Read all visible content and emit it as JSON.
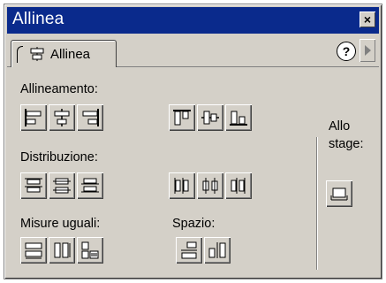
{
  "window": {
    "title": "Allinea",
    "close_glyph": "×"
  },
  "tab": {
    "label": "Allinea",
    "icon": "align-icon"
  },
  "help_glyph": "?",
  "sections": {
    "allineamento": "Allineamento:",
    "distribuzione": "Distribuzione:",
    "misure_uguali": "Misure uguali:",
    "spazio": "Spazio:",
    "allo_stage_line1": "Allo",
    "allo_stage_line2": "stage:"
  },
  "colors": {
    "titlebar": "#0a2a8c",
    "panel": "#d4d0c8"
  }
}
